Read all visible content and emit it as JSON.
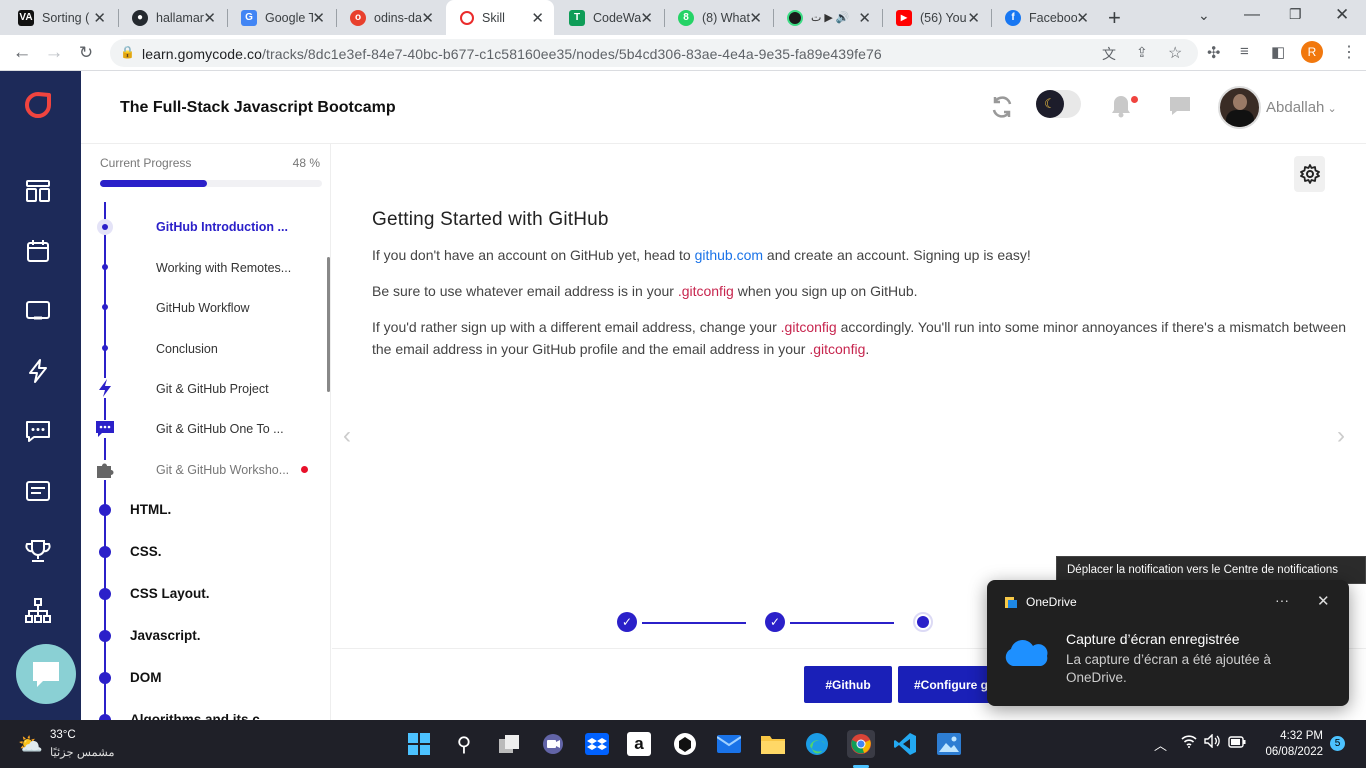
{
  "browser": {
    "tabs": [
      {
        "label": "Sorting (",
        "fav": "VA",
        "color": "#111111"
      },
      {
        "label": "hallamar",
        "fav": "GH",
        "color": "#24292f"
      },
      {
        "label": "Google T",
        "fav": "G",
        "color": "#4285f4"
      },
      {
        "label": "odins-da",
        "fav": "o",
        "color": "#e8402d"
      },
      {
        "label": "Skill",
        "fav": "S",
        "color": "#ea2b2b"
      },
      {
        "label": "CodeWa",
        "fav": "T",
        "color": "#0f9d58"
      },
      {
        "label": "(8) What",
        "fav": "8",
        "color": "#25d366"
      },
      {
        "label": "",
        "fav": "",
        "color": "#1b1b1b"
      },
      {
        "label": "(56) You",
        "fav": "▶",
        "color": "#ff0000"
      },
      {
        "label": "Faceboo",
        "fav": "f",
        "color": "#1877f2"
      }
    ],
    "new_tab": "+",
    "url_host": "learn.gomycode.co",
    "url_path": "/tracks/8dc1e3ef-84e7-40bc-b677-c1c58160ee35/nodes/5b4cd306-83ae-4e4a-9e35-fa89e439fe76",
    "profile_initial": "R"
  },
  "header": {
    "course_title": "The Full-Stack Javascript Bootcamp",
    "username": "Abdallah"
  },
  "sidebar": {
    "progress_label": "Current Progress",
    "progress_pct": "48 %",
    "progress_value": 0.48,
    "sub_items": [
      {
        "label": "GitHub Introduction ...",
        "current": true
      },
      {
        "label": "Working with Remotes...",
        "current": false
      },
      {
        "label": "GitHub Workflow",
        "current": false
      },
      {
        "label": "Conclusion",
        "current": false
      },
      {
        "label": "Git & GitHub Project",
        "current": false
      },
      {
        "label": "Git & GitHub One To ...",
        "current": false
      },
      {
        "label": "Git & GitHub Worksho...",
        "current": false
      }
    ],
    "modules": [
      "HTML.",
      "CSS.",
      "CSS Layout.",
      "Javascript.",
      "DOM",
      "Algorithms and its c..."
    ]
  },
  "content": {
    "heading": "Getting Started with GitHub",
    "p1_a": "If you don't have an account on GitHub yet, head to ",
    "p1_link": "github.com",
    "p1_b": " and create an account. Signing up is easy!",
    "p2_a": "Be sure to use whatever email address is in your ",
    "p2_code": ".gitconfig",
    "p2_b": " when you sign up on GitHub.",
    "p3_a": "If you'd rather sign up with a different email address, change your ",
    "p3_code": ".gitconfig",
    "p3_b": " accordingly. You'll run into some minor annoyances if there's a mismatch between the email address in your GitHub profile and the email address in your ",
    "p3_code2": ".gitconfig",
    "p3_c": ".",
    "tags": [
      "#Github",
      "#Configure git"
    ]
  },
  "notification": {
    "tooltip": "Déplacer la notification vers le Centre de notifications",
    "app": "OneDrive",
    "more": "···",
    "title": "Capture d’écran enregistrée",
    "body": "La capture d’écran a été ajoutée à OneDrive."
  },
  "taskbar": {
    "temp": "33°C",
    "weather": "مشمس جزئيًا",
    "time": "4:32 PM",
    "date": "06/08/2022",
    "notif_count": "5"
  },
  "colors": {
    "accent": "#2b20c9",
    "sidenav": "#1d2a59",
    "brand_red": "#f0443f"
  }
}
